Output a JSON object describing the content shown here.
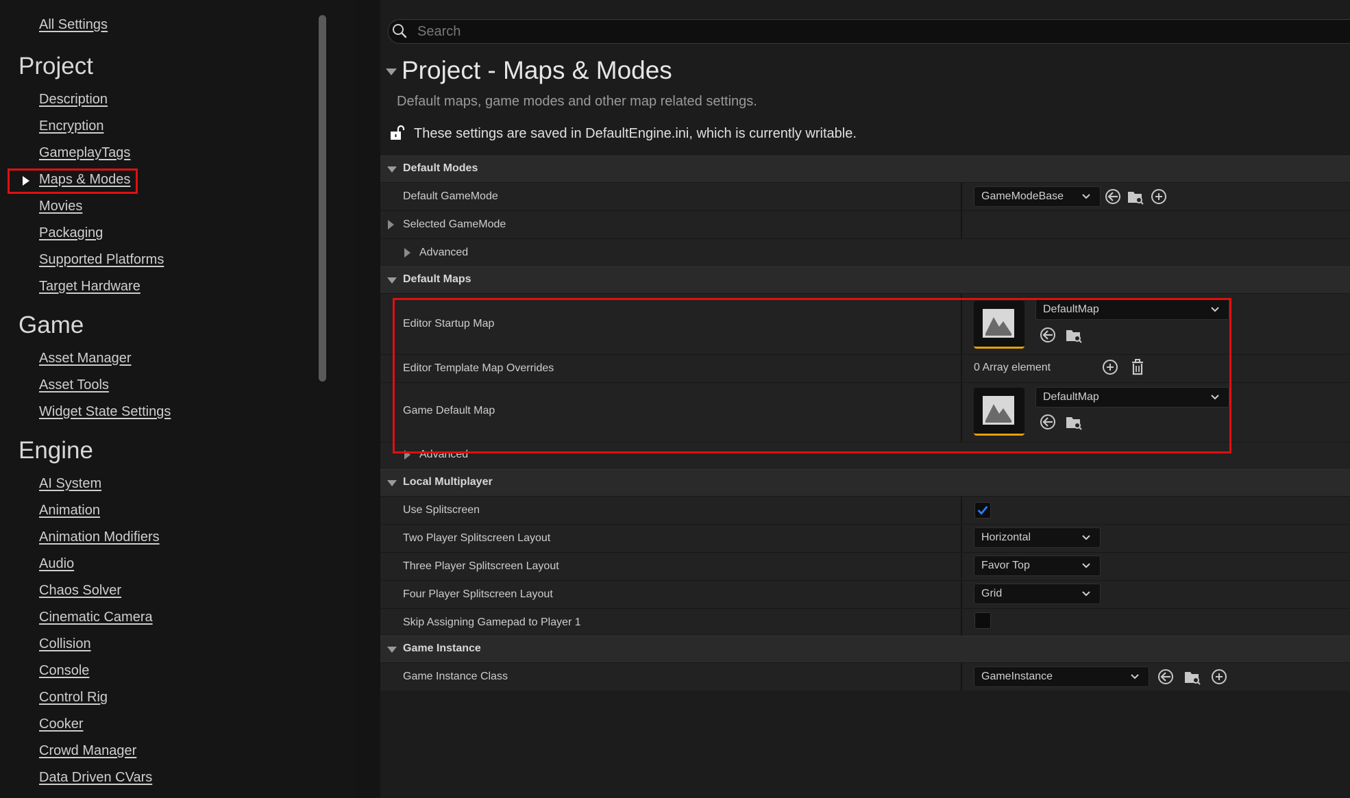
{
  "sidebar": {
    "all_settings": "All Settings",
    "categories": [
      {
        "title": "Project",
        "items": [
          "Description",
          "Encryption",
          "GameplayTags",
          "Maps & Modes",
          "Movies",
          "Packaging",
          "Supported Platforms",
          "Target Hardware"
        ]
      },
      {
        "title": "Game",
        "items": [
          "Asset Manager",
          "Asset Tools",
          "Widget State Settings"
        ]
      },
      {
        "title": "Engine",
        "items": [
          "AI System",
          "Animation",
          "Animation Modifiers",
          "Audio",
          "Chaos Solver",
          "Cinematic Camera",
          "Collision",
          "Console",
          "Control Rig",
          "Cooker",
          "Crowd Manager",
          "Data Driven CVars"
        ]
      }
    ],
    "selected": "Maps & Modes"
  },
  "search": {
    "placeholder": "Search"
  },
  "header": {
    "title": "Project - Maps & Modes",
    "subtitle": "Default maps, game modes and other map related settings.",
    "notice": "These settings are saved in DefaultEngine.ini, which is currently writable."
  },
  "sections": {
    "default_modes": {
      "title": "Default Modes",
      "default_gamemode_label": "Default GameMode",
      "default_gamemode_value": "GameModeBase",
      "selected_gamemode_label": "Selected GameMode",
      "advanced_label": "Advanced"
    },
    "default_maps": {
      "title": "Default Maps",
      "editor_startup_map_label": "Editor Startup Map",
      "editor_startup_map_value": "DefaultMap",
      "editor_template_label": "Editor Template Map Overrides",
      "editor_template_value": "0 Array element",
      "game_default_map_label": "Game Default Map",
      "game_default_map_value": "DefaultMap",
      "advanced_label": "Advanced"
    },
    "local_multiplayer": {
      "title": "Local Multiplayer",
      "use_splitscreen_label": "Use Splitscreen",
      "use_splitscreen_checked": true,
      "two_player_label": "Two Player Splitscreen Layout",
      "two_player_value": "Horizontal",
      "three_player_label": "Three Player Splitscreen Layout",
      "three_player_value": "Favor Top",
      "four_player_label": "Four Player Splitscreen Layout",
      "four_player_value": "Grid",
      "skip_gamepad_label": "Skip Assigning Gamepad to Player 1",
      "skip_gamepad_checked": false
    },
    "game_instance": {
      "title": "Game Instance",
      "game_instance_class_label": "Game Instance Class",
      "game_instance_class_value": "GameInstance"
    }
  },
  "colors": {
    "highlight": "#e01010",
    "accent_check": "#2a7fff",
    "thumb_underline": "#e8a000"
  }
}
